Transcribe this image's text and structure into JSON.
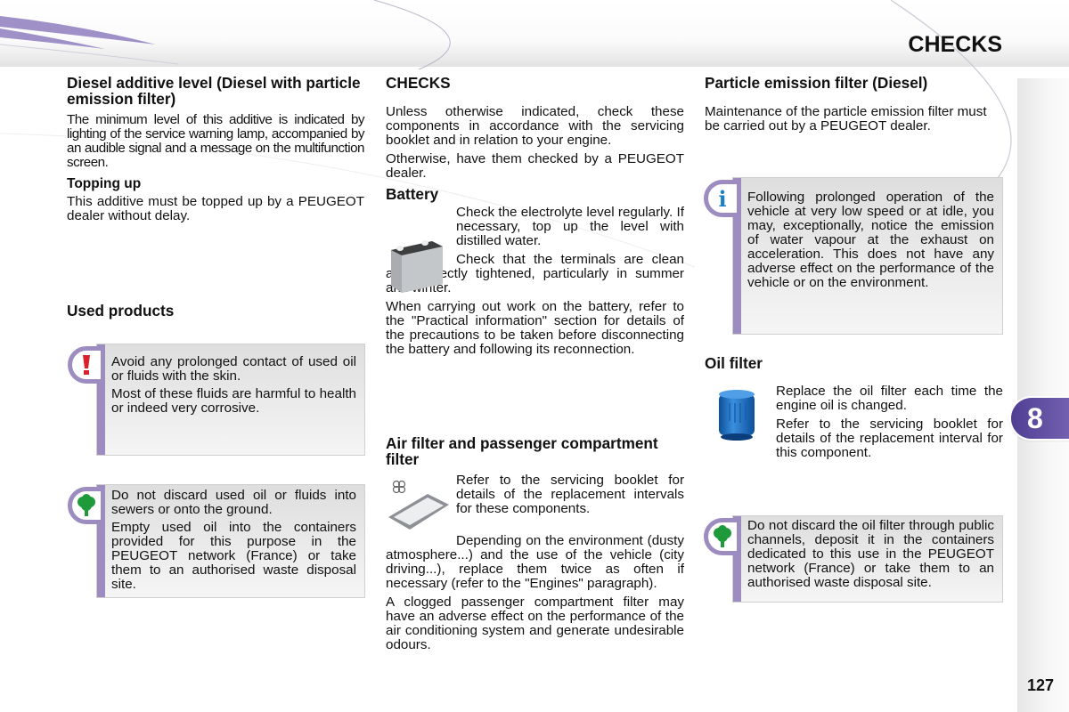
{
  "header": {
    "title": "CHECKS"
  },
  "chapter": {
    "number": "8"
  },
  "page_number": "127",
  "left": {
    "diesel_heading": "Diesel additive level (Diesel with particle emission filter)",
    "diesel_text": "The minimum level of this additive is indicated by lighting of the service warning lamp, accompanied by an audible signal and a message on the multifunction screen.",
    "topping_heading": "Topping up",
    "topping_text": "This additive must be topped up by a PEUGEOT dealer without delay.",
    "used_heading": "Used products",
    "warning_note": [
      "Avoid any prolonged contact of used oil or fluids with the skin.",
      "Most of these fluids are harmful to health or indeed very corrosive."
    ],
    "env_note": [
      "Do not discard used oil or fluids into sewers or onto the ground.",
      "Empty used oil into the containers provided for this purpose in the PEUGEOT network (France) or take them to an authorised waste disposal site."
    ]
  },
  "middle": {
    "checks_heading": "CHECKS",
    "checks_text": [
      "Unless otherwise indicated, check these components in accordance with the servicing booklet and in relation to your engine.",
      "Otherwise, have them checked by a PEUGEOT dealer."
    ],
    "battery_heading": "Battery",
    "battery_text": [
      "Check the electrolyte level regularly. If necessary, top up the level with distilled water.",
      "Check that the terminals are clean and correctly tightened, particularly in summer and winter.",
      "When carrying out work on the battery, refer to the \"Practical information\" section for details of the precautions to be taken before disconnecting the battery and following its reconnection."
    ],
    "air_heading": "Air filter and passenger compartment filter",
    "air_text": [
      "Refer to the servicing booklet for details of the replacement intervals for these components.",
      "Depending on the environment (dusty atmosphere...) and the use of the vehicle (city driving...), replace them twice as often if necessary (refer to the \"Engines\" paragraph).",
      "A clogged passenger compartment filter may have an adverse effect on the performance of the air conditioning system and generate undesirable odours."
    ]
  },
  "right": {
    "pef_heading": "Particle emission filter (Diesel)",
    "pef_text": "Maintenance of the particle emission filter must be carried out by a PEUGEOT dealer.",
    "info_note": "Following prolonged operation of the vehicle at very low speed or at idle, you may, exceptionally, notice the emission of water vapour at the exhaust on acceleration. This does not have any adverse effect on the performance of the vehicle or on the environment.",
    "oil_heading": "Oil filter",
    "oil_text": [
      "Replace the oil filter each time the engine oil is changed.",
      "Refer to the servicing booklet for details of the replacement interval for this component."
    ],
    "env_note": "Do not discard the oil filter through public channels, deposit it in the containers dedicated to this use in the PEUGEOT network (France) or take them to an authorised waste disposal site."
  },
  "colors": {
    "accent": "#9c8cc0",
    "tab": "#5a4a9e",
    "warning": "#d9202c",
    "info": "#1a7fc4",
    "eco": "#1e9a3a"
  }
}
